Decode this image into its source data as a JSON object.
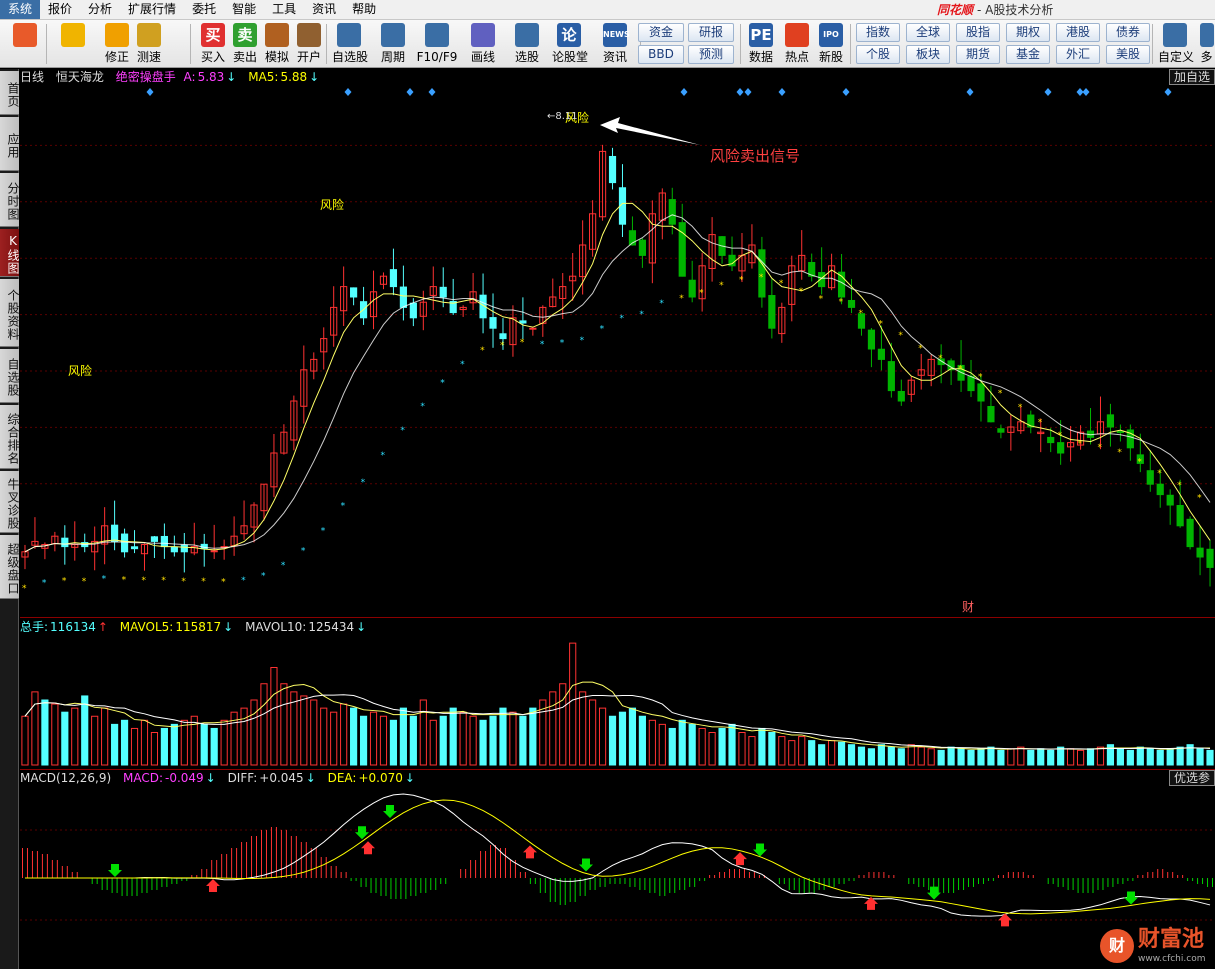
{
  "menubar": {
    "items": [
      "系统",
      "报价",
      "分析",
      "扩展行情",
      "委托",
      "智能",
      "工具",
      "资讯",
      "帮助"
    ],
    "brand": "同花顺",
    "subtitle": "- A股技术分析"
  },
  "toolbar": {
    "buttons": [
      {
        "label": "",
        "icon": "mosaic-icon"
      },
      {
        "label": "",
        "icon": "back-arrow-icon"
      },
      {
        "label": "修正",
        "icon": "up-down-icon"
      },
      {
        "label": "测速",
        "icon": "timer-icon"
      },
      {
        "label": "买入",
        "icon": "buy-icon",
        "glyph": "买"
      },
      {
        "label": "卖出",
        "icon": "sell-icon",
        "glyph": "卖"
      },
      {
        "label": "模拟",
        "icon": "hammer-icon"
      },
      {
        "label": "开户",
        "icon": "lock-icon"
      },
      {
        "label": "自选股",
        "icon": "star-icon"
      },
      {
        "label": "周期",
        "icon": "clock-icon"
      },
      {
        "label": "F10/F9",
        "icon": "f10-icon"
      },
      {
        "label": "画线",
        "icon": "pen-icon"
      },
      {
        "label": "选股",
        "icon": "screen-icon"
      },
      {
        "label": "论股堂",
        "icon": "forum-icon",
        "glyph": "论"
      },
      {
        "label": "资讯",
        "icon": "news-icon",
        "glyph": "NEWS"
      },
      {
        "label": "数据",
        "icon": "pe-icon",
        "glyph": "PE"
      },
      {
        "label": "热点",
        "icon": "hot-icon"
      },
      {
        "label": "新股",
        "icon": "ipo-icon",
        "glyph": "IPO"
      },
      {
        "label": "自定义",
        "icon": "custom-icon"
      }
    ],
    "quick_top": [
      "资金",
      "研报"
    ],
    "quick_bottom": [
      "BBD",
      "预测"
    ],
    "market_top": [
      "指数",
      "全球",
      "股指",
      "期权",
      "港股",
      "债券"
    ],
    "market_bottom": [
      "个股",
      "板块",
      "期货",
      "基金",
      "外汇",
      "美股"
    ],
    "overflow_label": "多"
  },
  "sidebar": {
    "tabs": [
      "首页",
      "应用",
      "分时图",
      "K线图",
      "个股资料",
      "自选股",
      "综合排名",
      "牛叉诊股",
      "超级盘口"
    ]
  },
  "kline": {
    "period": "日线",
    "stock": "恒天海龙",
    "indicator": "绝密操盘手",
    "a_label": "A:",
    "a_value": "5.83",
    "ma5_label": "MA5:",
    "ma5_value": "5.88",
    "add_button": "加自选",
    "risk_label": "风险",
    "peak_price": "8.11",
    "annotation": "风险卖出信号",
    "fin_marker": "财"
  },
  "volume": {
    "total_label": "总手:",
    "total_value": "116134",
    "mavol5_label": "MAVOL5:",
    "mavol5_value": "115817",
    "mavol10_label": "MAVOL10:",
    "mavol10_value": "125434"
  },
  "macd": {
    "name": "MACD(12,26,9)",
    "macd_label": "MACD:",
    "macd_value": "-0.049",
    "diff_label": "DIFF:",
    "diff_value": "+0.045",
    "dea_label": "DEA:",
    "dea_value": "+0.070",
    "pick_button": "优选参"
  },
  "watermark": {
    "name": "财富池",
    "url": "www.cfchi.com"
  },
  "colors": {
    "up": "#ff3232",
    "down": "#54ffff",
    "down_green": "#00b400",
    "ma": "#ffff00",
    "grid": "#8b0000"
  },
  "chart_data": {
    "type": "candlestick",
    "closes": [
      4.05,
      4.15,
      4.12,
      4.2,
      4.1,
      4.12,
      4.1,
      4.15,
      4.3,
      4.15,
      4.05,
      4.08,
      4.12,
      4.15,
      4.1,
      4.05,
      4.05,
      4.1,
      4.08,
      4.06,
      4.1,
      4.2,
      4.3,
      4.5,
      4.7,
      5.0,
      5.2,
      5.5,
      5.8,
      5.9,
      6.1,
      6.4,
      6.6,
      6.5,
      6.3,
      6.55,
      6.7,
      6.6,
      6.4,
      6.3,
      6.45,
      6.6,
      6.5,
      6.35,
      6.4,
      6.55,
      6.3,
      6.2,
      6.1,
      6.3,
      6.25,
      6.2,
      6.4,
      6.5,
      6.6,
      6.7,
      7.0,
      7.3,
      7.9,
      7.6,
      7.2,
      7.0,
      6.9,
      7.3,
      7.5,
      7.2,
      6.7,
      6.5,
      6.8,
      7.1,
      6.9,
      6.8,
      6.9,
      7.0,
      6.5,
      6.2,
      6.4,
      6.8,
      6.9,
      6.7,
      6.6,
      6.8,
      6.5,
      6.4,
      6.2,
      6.0,
      5.9,
      5.6,
      5.5,
      5.7,
      5.8,
      5.9,
      5.85,
      5.8,
      5.7,
      5.6,
      5.5,
      5.3,
      5.2,
      5.25,
      5.3,
      5.25,
      5.2,
      5.1,
      5.0,
      5.1,
      5.2,
      5.15,
      5.3,
      5.25,
      5.2,
      5.05,
      4.9,
      4.7,
      4.6,
      4.5,
      4.3,
      4.1,
      4.0,
      3.9
    ],
    "ylim": [
      3.5,
      8.5
    ],
    "volumes": [
      60,
      90,
      80,
      75,
      65,
      70,
      85,
      60,
      70,
      50,
      55,
      45,
      55,
      40,
      45,
      50,
      55,
      60,
      50,
      45,
      55,
      65,
      70,
      80,
      100,
      120,
      100,
      90,
      85,
      80,
      70,
      65,
      75,
      70,
      60,
      65,
      60,
      55,
      70,
      60,
      80,
      55,
      60,
      70,
      65,
      60,
      55,
      60,
      70,
      65,
      60,
      70,
      80,
      90,
      100,
      150,
      90,
      80,
      70,
      60,
      65,
      70,
      60,
      55,
      50,
      45,
      55,
      50,
      45,
      40,
      45,
      50,
      40,
      35,
      45,
      40,
      35,
      30,
      35,
      30,
      25,
      30,
      28,
      25,
      22,
      20,
      25,
      22,
      20,
      25,
      22,
      20,
      18,
      22,
      20,
      18,
      20,
      22,
      18,
      20,
      22,
      18,
      20,
      18,
      22,
      20,
      18,
      20,
      22,
      25,
      20,
      18,
      22,
      20,
      18,
      20,
      22,
      25,
      20,
      18
    ],
    "macd_hist": [
      0.1,
      0.09,
      0.08,
      0.06,
      0.04,
      0.02,
      0.0,
      -0.02,
      -0.04,
      -0.05,
      -0.06,
      -0.06,
      -0.05,
      -0.04,
      -0.03,
      -0.02,
      -0.01,
      0.01,
      0.03,
      0.06,
      0.08,
      0.1,
      0.12,
      0.14,
      0.16,
      0.17,
      0.16,
      0.14,
      0.12,
      0.1,
      0.07,
      0.04,
      0.02,
      -0.01,
      -0.03,
      -0.05,
      -0.06,
      -0.07,
      -0.07,
      -0.06,
      -0.05,
      -0.04,
      -0.02,
      0.0,
      0.03,
      0.06,
      0.09,
      0.11,
      0.1,
      0.06,
      0.02,
      -0.02,
      -0.05,
      -0.08,
      -0.09,
      -0.08,
      -0.06,
      -0.04,
      -0.03,
      -0.02,
      -0.02,
      -0.03,
      -0.04,
      -0.05,
      -0.06,
      -0.05,
      -0.04,
      -0.03,
      -0.01,
      0.01,
      0.02,
      0.03,
      0.03,
      0.02,
      0.01,
      0.0,
      -0.02,
      -0.04,
      -0.05,
      -0.05,
      -0.04,
      -0.03,
      -0.02,
      -0.01,
      0.01,
      0.02,
      0.02,
      0.01,
      0.0,
      -0.02,
      -0.03,
      -0.04,
      -0.05,
      -0.05,
      -0.04,
      -0.03,
      -0.02,
      -0.01,
      0.01,
      0.02,
      0.02,
      0.01,
      0.0,
      -0.02,
      -0.03,
      -0.04,
      -0.05,
      -0.05,
      -0.04,
      -0.03,
      -0.02,
      -0.01,
      0.01,
      0.02,
      0.03,
      0.02,
      0.01,
      -0.01,
      -0.02,
      -0.03
    ]
  }
}
